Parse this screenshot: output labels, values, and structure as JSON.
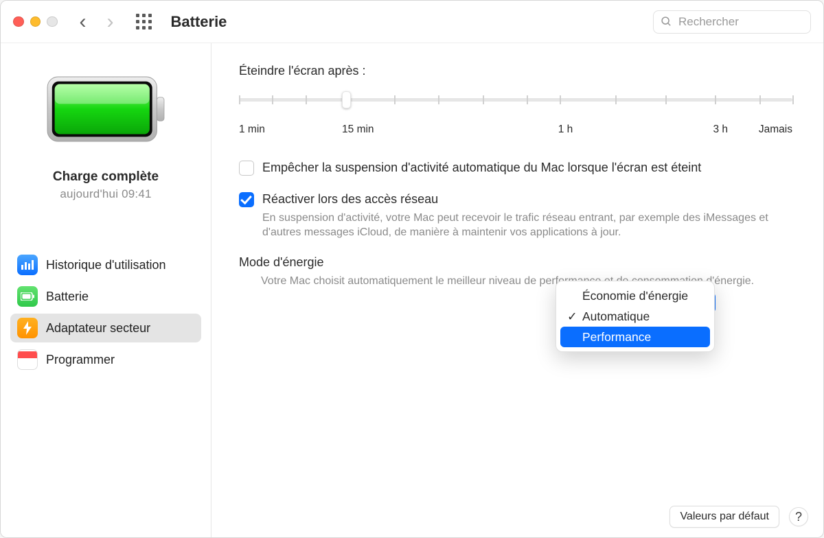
{
  "toolbar": {
    "title": "Batterie",
    "search_placeholder": "Rechercher"
  },
  "sidebar": {
    "status_title": "Charge complète",
    "status_subtitle": "aujourd'hui 09:41",
    "items": [
      {
        "label": "Historique d'utilisation"
      },
      {
        "label": "Batterie"
      },
      {
        "label": "Adaptateur secteur"
      },
      {
        "label": "Programmer"
      }
    ]
  },
  "main": {
    "slider_label": "Éteindre l'écran après :",
    "ticks": {
      "t1": "1 min",
      "t2": "15 min",
      "t3": "1 h",
      "t4": "3 h",
      "t5": "Jamais"
    },
    "prevent_sleep_label": "Empêcher la suspension d'activité automatique du Mac lorsque l'écran est éteint",
    "wake_network_label": "Réactiver lors des accès réseau",
    "wake_network_desc": "En suspension d'activité, votre Mac peut recevoir le trafic réseau entrant, par exemple des iMessages et d'autres messages iCloud, de manière à maintenir vos applications à jour.",
    "energy_mode_label": "Mode d'énergie",
    "energy_mode_desc": "Votre Mac choisit automatiquement le meilleur niveau de performance et de consommation d'énergie.",
    "dropdown": {
      "opt1": "Économie d'énergie",
      "opt2": "Automatique",
      "opt3": "Performance",
      "selected": "Automatique",
      "highlighted": "Performance"
    }
  },
  "footer": {
    "defaults": "Valeurs par défaut"
  }
}
